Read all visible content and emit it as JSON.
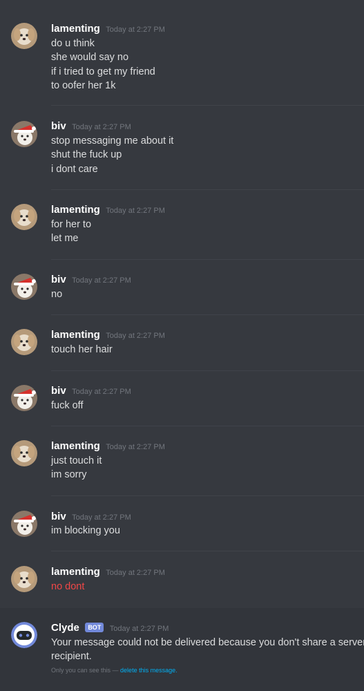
{
  "messages": [
    {
      "username": "lamenting",
      "timestamp": "Today at 2:27 PM",
      "avatar": "dog-avatar-icon",
      "lines": [
        "do u think",
        "she would say no",
        "if i tried to get my friend",
        "to oofer her 1k"
      ]
    },
    {
      "username": "biv",
      "timestamp": "Today at 2:27 PM",
      "avatar": "santa-dog-avatar-icon",
      "lines": [
        "stop messaging me about it",
        "shut the fuck up",
        "i dont care"
      ]
    },
    {
      "username": "lamenting",
      "timestamp": "Today at 2:27 PM",
      "avatar": "dog-avatar-icon",
      "lines": [
        "for her to",
        "let me"
      ]
    },
    {
      "username": "biv",
      "timestamp": "Today at 2:27 PM",
      "avatar": "santa-dog-avatar-icon",
      "lines": [
        "no"
      ]
    },
    {
      "username": "lamenting",
      "timestamp": "Today at 2:27 PM",
      "avatar": "dog-avatar-icon",
      "lines": [
        "touch her hair"
      ]
    },
    {
      "username": "biv",
      "timestamp": "Today at 2:27 PM",
      "avatar": "santa-dog-avatar-icon",
      "lines": [
        "fuck off"
      ]
    },
    {
      "username": "lamenting",
      "timestamp": "Today at 2:27 PM",
      "avatar": "dog-avatar-icon",
      "lines": [
        "just touch it",
        "im sorry"
      ]
    },
    {
      "username": "biv",
      "timestamp": "Today at 2:27 PM",
      "avatar": "santa-dog-avatar-icon",
      "lines": [
        "im blocking you"
      ]
    },
    {
      "username": "lamenting",
      "timestamp": "Today at 2:27 PM",
      "avatar": "dog-avatar-icon",
      "lines": [
        "no dont"
      ],
      "failed": true,
      "failed_color": "#f04747"
    }
  ],
  "system_message": {
    "username": "Clyde",
    "tag": "BOT",
    "timestamp": "Today at 2:27 PM",
    "avatar": "clyde-bot-avatar-icon",
    "lines": [
      "Your message could not be delivered because you don't share a server w",
      "recipient."
    ],
    "note_prefix": "Only you can see this — ",
    "note_link": "delete this message."
  },
  "colors": {
    "background": "#36393f",
    "username": "#ffffff",
    "timestamp": "#72767d",
    "text": "#dcddde",
    "error": "#f04747",
    "bot_tag": "#7289da",
    "link": "#00b0f4"
  }
}
